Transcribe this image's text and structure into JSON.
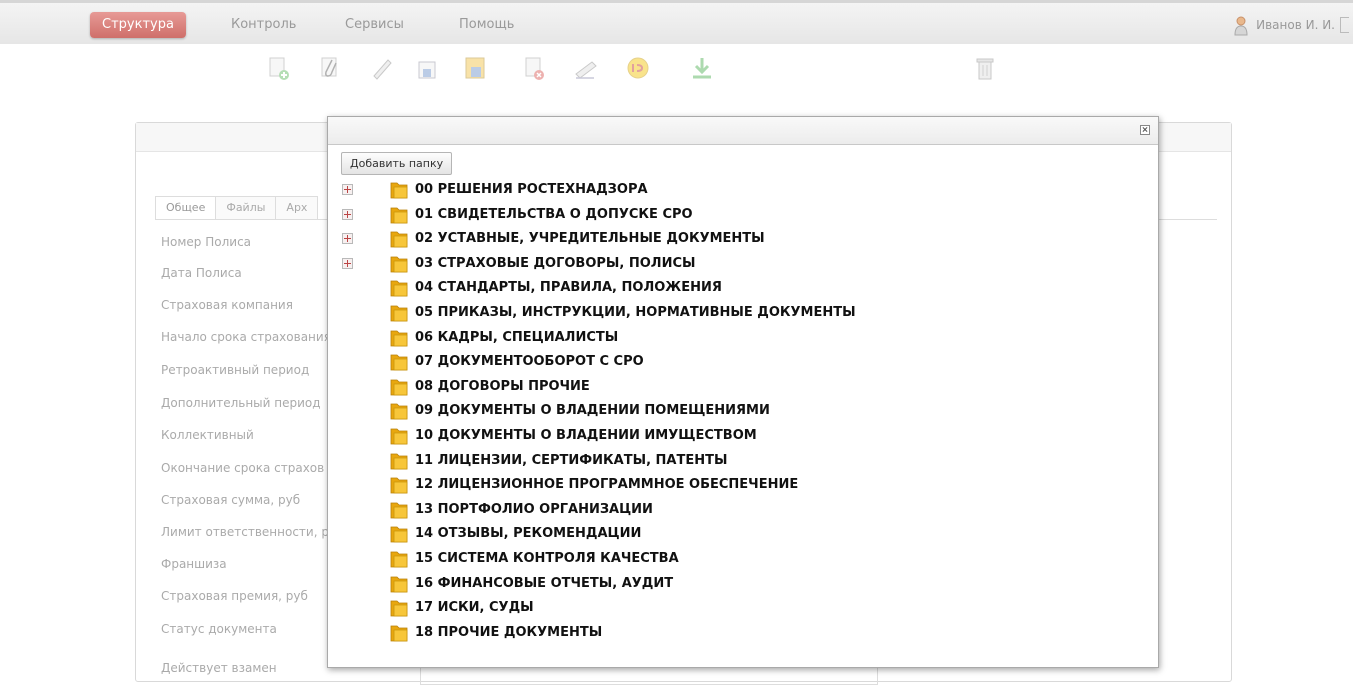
{
  "menu": {
    "items": [
      {
        "label": "Структура",
        "active": true
      },
      {
        "label": "Контроль",
        "active": false
      },
      {
        "label": "Сервисы",
        "active": false
      },
      {
        "label": "Помощь",
        "active": false
      }
    ],
    "user_name": "Иванов И. И."
  },
  "toolbar": {
    "icons": [
      "add-icon",
      "attach-icon",
      "edit-icon",
      "save-icon",
      "save-as-icon",
      "delete-doc-icon",
      "sign-icon",
      "export-1c-icon",
      "download-icon",
      "trash-icon"
    ]
  },
  "form": {
    "tabs": [
      {
        "label": "Общее",
        "active": true
      },
      {
        "label": "Файлы",
        "active": false
      },
      {
        "label": "Арх",
        "active": false
      }
    ],
    "fields": [
      "Номер Полиса",
      "Дата Полиса",
      "Страховая компания",
      "Начало срока страхования",
      "Ретроактивный период",
      "Дополнительный период",
      "Коллективный",
      "Окончание срока страхов",
      "Страховая сумма, руб",
      "Лимит ответственности, ру",
      "Франшиза",
      "Страховая премия, руб",
      "Статус документа",
      "Действует взамен"
    ]
  },
  "dialog": {
    "add_folder_label": "Добавить папку",
    "folders": [
      {
        "label": "00 РЕШЕНИЯ РОСТЕХНАДЗОРА",
        "expandable": true
      },
      {
        "label": "01 СВИДЕТЕЛЬСТВА О ДОПУСКЕ СРО",
        "expandable": true
      },
      {
        "label": "02 УСТАВНЫЕ, УЧРЕДИТЕЛЬНЫЕ ДОКУМЕНТЫ",
        "expandable": true
      },
      {
        "label": "03 СТРАХОВЫЕ ДОГОВОРЫ, ПОЛИСЫ",
        "expandable": true
      },
      {
        "label": "04 СТАНДАРТЫ, ПРАВИЛА, ПОЛОЖЕНИЯ",
        "expandable": false
      },
      {
        "label": "05 ПРИКАЗЫ, ИНСТРУКЦИИ, НОРМАТИВНЫЕ ДОКУМЕНТЫ",
        "expandable": false
      },
      {
        "label": "06 КАДРЫ, СПЕЦИАЛИСТЫ",
        "expandable": false
      },
      {
        "label": "07 ДОКУМЕНТООБОРОТ С СРО",
        "expandable": false
      },
      {
        "label": "08 ДОГОВОРЫ ПРОЧИЕ",
        "expandable": false
      },
      {
        "label": "09 ДОКУМЕНТЫ О ВЛАДЕНИИ ПОМЕЩЕНИЯМИ",
        "expandable": false
      },
      {
        "label": "10 ДОКУМЕНТЫ О ВЛАДЕНИИ ИМУЩЕСТВОМ",
        "expandable": false
      },
      {
        "label": "11 ЛИЦЕНЗИИ, СЕРТИФИКАТЫ, ПАТЕНТЫ",
        "expandable": false
      },
      {
        "label": "12 ЛИЦЕНЗИОННОЕ ПРОГРАММНОЕ ОБЕСПЕЧЕНИЕ",
        "expandable": false
      },
      {
        "label": "13 ПОРТФОЛИО ОРГАНИЗАЦИИ",
        "expandable": false
      },
      {
        "label": "14 ОТЗЫВЫ, РЕКОМЕНДАЦИИ",
        "expandable": false
      },
      {
        "label": "15 СИСТЕМА КОНТРОЛЯ КАЧЕСТВА",
        "expandable": false
      },
      {
        "label": "16 ФИНАНСОВЫЕ ОТЧЕТЫ, АУДИТ",
        "expandable": false
      },
      {
        "label": "17 ИСКИ, СУДЫ",
        "expandable": false
      },
      {
        "label": "18 ПРОЧИЕ ДОКУМЕНТЫ",
        "expandable": false
      }
    ]
  }
}
